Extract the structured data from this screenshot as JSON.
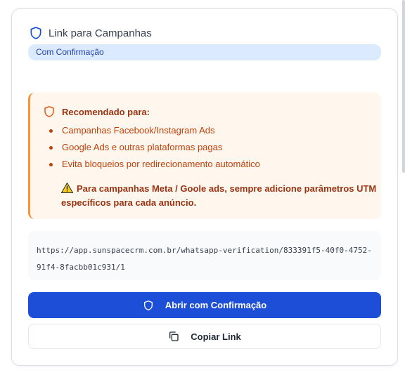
{
  "header": {
    "title": "Link para Campanhas",
    "icon": "shield-icon"
  },
  "badge": {
    "label": "Com Confirmação"
  },
  "alert": {
    "title": "Recomendado para:",
    "items": [
      "Campanhas Facebook/Instagram Ads",
      "Google Ads e outras plataformas pagas",
      "Evita bloqueios por redirecionamento automático"
    ],
    "note": "Para campanhas Meta / Goole ads, sempre adicione parâmetros UTM específicos para cada anúncio.",
    "note_icon": "warning-icon"
  },
  "url": {
    "text": "https://app.sunspacecrm.com.br/whatsapp-verification/833391f5-40f0-4752-91f4-8facbb01c931/1"
  },
  "buttons": {
    "open_label": "Abrir com Confirmação",
    "copy_label": "Copiar Link"
  },
  "colors": {
    "primary": "#1d4ed8",
    "badge_bg": "#dbeafe",
    "alert_bg": "#fff7ed",
    "alert_border": "#fb923c",
    "alert_text": "#c2410c"
  }
}
